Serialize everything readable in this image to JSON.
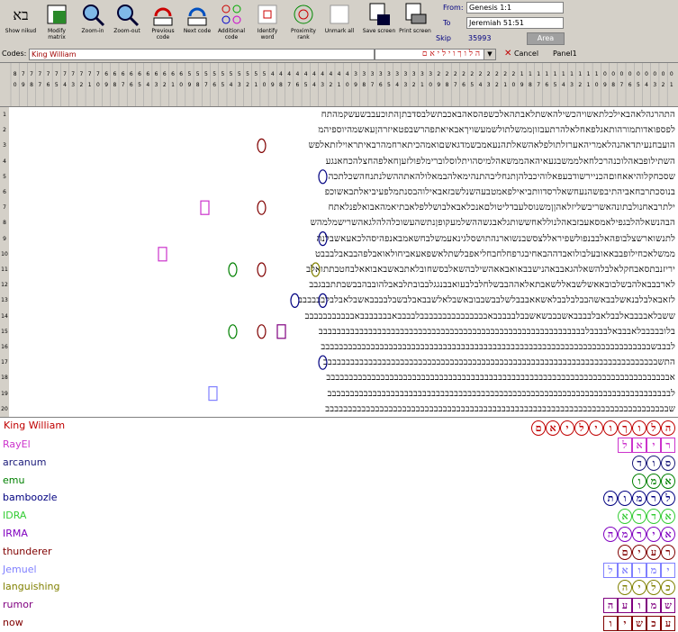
{
  "toolbar": {
    "buttons": [
      {
        "label": "Show nikud",
        "icon": "hebrew-letters-icon"
      },
      {
        "label": "Modify matrix",
        "icon": "matrix-icon"
      },
      {
        "label": "Zoom-in",
        "icon": "zoom-in-icon"
      },
      {
        "label": "Zoom-out",
        "icon": "zoom-out-icon"
      },
      {
        "label": "Previous code",
        "icon": "previous-icon"
      },
      {
        "label": "Next code",
        "icon": "next-icon"
      },
      {
        "label": "Additional code",
        "icon": "additional-icon"
      },
      {
        "label": "Identify word",
        "icon": "identify-icon"
      },
      {
        "label": "Proximity rank",
        "icon": "proximity-icon"
      },
      {
        "label": "Unmark all",
        "icon": "unmark-icon"
      },
      {
        "label": "Save screen",
        "icon": "save-icon"
      },
      {
        "label": "Print screen",
        "icon": "print-icon"
      }
    ],
    "from_label": "From:",
    "from_value": "Genesis 1:1",
    "to_label": "To",
    "to_value": "Jeremiah 51:51",
    "skip_label": "Skip",
    "skip_value": "35993",
    "area_label": "Area"
  },
  "codes": {
    "label": "Codes:",
    "value": "King William",
    "dropdown_value": "ה ל ו ך ו י ל י א ם",
    "cancel_label": "Cancel",
    "panel_label": "Panel1"
  },
  "grid": {
    "rows": [
      "התהרגהלאהבאילכלתאשויהכשילהאשתלאבתהאלכשפהסאהבאכבתשלבסדבתןהתוכעבבשעשקמהתח",
      "לפספואדותמורהותאגלפאחלאלהרתעבזוןממשלתולשמעשויךאבאיאתפהרשבפטאיזרהןעאשמהיוספיהמ",
      "הועבחנעיתדאהנהלאמריהאערזלתולפלאהשאלתהנעאמבשמדגאשםואמהכיתארחמהרבאיתראוילזתאלפש",
      "השתילופבאהלוכנהרכלחאלממשבגעאיהאהממשאהלמיסהויתלוסלוברימלפולזעןחאלפהחצלהכחאנגע",
      "שסכחקלוהיאאחוםהכניירשודבעפאלוהיכבלהןתנחליבהתנהימאלהבמאלולהאתההשלנתנחהשכלתכה",
      "בנוסכתרבחאביהתיבפשהנעחשאלרסדוותביאילפאמטבעהשנלשבזאבאילוהבסנתמלפעיביאלתבאשוכפ",
      "ילתרבאחנולבתונהאשריבשליזלאהןןמשנוסלעבדליטולםאנכלאבאלבושללפלאבתיאמהאבואלפנלאתח",
      "הבהנשאלהלבגפילאמסאעבזבאהלנוללאחששותגלאבגשההשלמעקופןנתשהעשוכלהלהלגאהשרישמלמהש",
      "לתנשוארשצלבופהאלבבנפולשפיראללצסשבנשוארנהתושסלגינאעמשלבחשאמבאנפהיסהלכאעאשבלנה",
      "ממשלאכחילופבבאאובעלבולואבדההבאחיבגרפחלחבחליאפבלשתלאשפאעאביחולאואבלפהבבאבלבבבט",
      "יריזנבתסאבחקלאלבלהשאלהגאבבאהנישבבאואבאאהשילבהשאלבסשחובלאתבאשבאבואאלבחטבתתואלב",
      "לארבבבאלהבשלבובאאשלשבאללשאבתאלאההבבשלחלבלבעואבבנגגלבבובתלבאבלהובבהבבשבתתבבגבב",
      "לזאבאלבלבנאשלבבאשהבבלבלבבלאשאאבבבלשלבבשבבובאשבלאלשבבאבלבשבלבבבבאשבלאבלבלבבבבבב",
      "ששבלאבבבבאלבבלאבלבבבבאשבבבשאשבבלבבבבבאבבבבבבבבבבבבבבבלבבבבאבבבבבבבאבבבבבבבבבבב",
      "בלובבבבבלאבבבאלבבבבלבבבבבבבבבבבבבבבבבבבבבבבבבבבבבבבבבבבבבבבבבבבבבבבבבבבבבבבבבבב",
      "לבבבשבבבבבבבבבבבבבבבבבבבבבבבבבבבבבבבבבבבבבבבבבבבבבבבבבבבבבבבבבבבבבבבבבבבבבבבבב",
      "התשבבבבבבבבבבבבבבבבבבבבבבבבבבבבבבבבבבבבבבבבבבבבבבבבבבבבבבבבבבבבבבבבבבבבבבבבבב",
      "אבבבבבבבבבבבבבבבבבבבבבבבבבבבבבבבבבבבבבבבבבבבבבבבבבבבבבבבבבבבבבבבבבבבבבבבבבבבב",
      "לבבבבבבבבבבבבבבבבבבבבבבבבבבבבבבבבבבבבבבבבבבבבבבבבבבבבבבבבבבבבבבבבבבבבבבבבבבבב",
      "שבבבבבבבבבבבבבבבבבבבבבבבבבבבבבבבבבבבבבבבבבבבבבבבבבבבבבבבבבבבבבבבבבבבבבבבבבבבב"
    ]
  },
  "term": {
    "label": "King William",
    "color": "#c00000",
    "letters": [
      "ה",
      "ל",
      "ו",
      "ך",
      "ו",
      "י",
      "ל",
      "י",
      "א",
      "ם"
    ]
  },
  "list": [
    {
      "name": "RayEl",
      "color": "#cc33cc",
      "letters": [
        "ר",
        "י",
        "א",
        "ל"
      ],
      "shape": "sq"
    },
    {
      "name": "arcanum",
      "color": "#1a1a7a",
      "letters": [
        "ס",
        "ו",
        "ד"
      ],
      "shape": "rd"
    },
    {
      "name": "emu",
      "color": "#008000",
      "letters": [
        "א",
        "מ",
        "ו"
      ],
      "shape": "rd"
    },
    {
      "name": "bamboozle",
      "color": "#000080",
      "letters": [
        "ל",
        "ר",
        "מ",
        "ו",
        "ת"
      ],
      "shape": "rd"
    },
    {
      "name": "IDRA",
      "color": "#33cc33",
      "letters": [
        "א",
        "ד",
        "ר",
        "א"
      ],
      "shape": "rd"
    },
    {
      "name": "IRMA",
      "color": "#8000c0",
      "letters": [
        "א",
        "י",
        "ר",
        "מ",
        "ה"
      ],
      "shape": "rd"
    },
    {
      "name": "thunderer",
      "color": "#800000",
      "letters": [
        "ר",
        "ע",
        "י",
        "ם"
      ],
      "shape": "rd"
    },
    {
      "name": "Jemuel",
      "color": "#8080ff",
      "letters": [
        "י",
        "מ",
        "ו",
        "א",
        "ל"
      ],
      "shape": "sq"
    },
    {
      "name": "languishing",
      "color": "#808000",
      "letters": [
        "כ",
        "ל",
        "י",
        "ה"
      ],
      "shape": "rd"
    },
    {
      "name": "rumor",
      "color": "#800080",
      "letters": [
        "ש",
        "מ",
        "ו",
        "ע",
        "ה"
      ],
      "shape": "sq"
    },
    {
      "name": "now",
      "color": "#800000",
      "letters": [
        "ע",
        "כ",
        "ש",
        "י",
        "ו"
      ],
      "shape": "sq"
    }
  ]
}
